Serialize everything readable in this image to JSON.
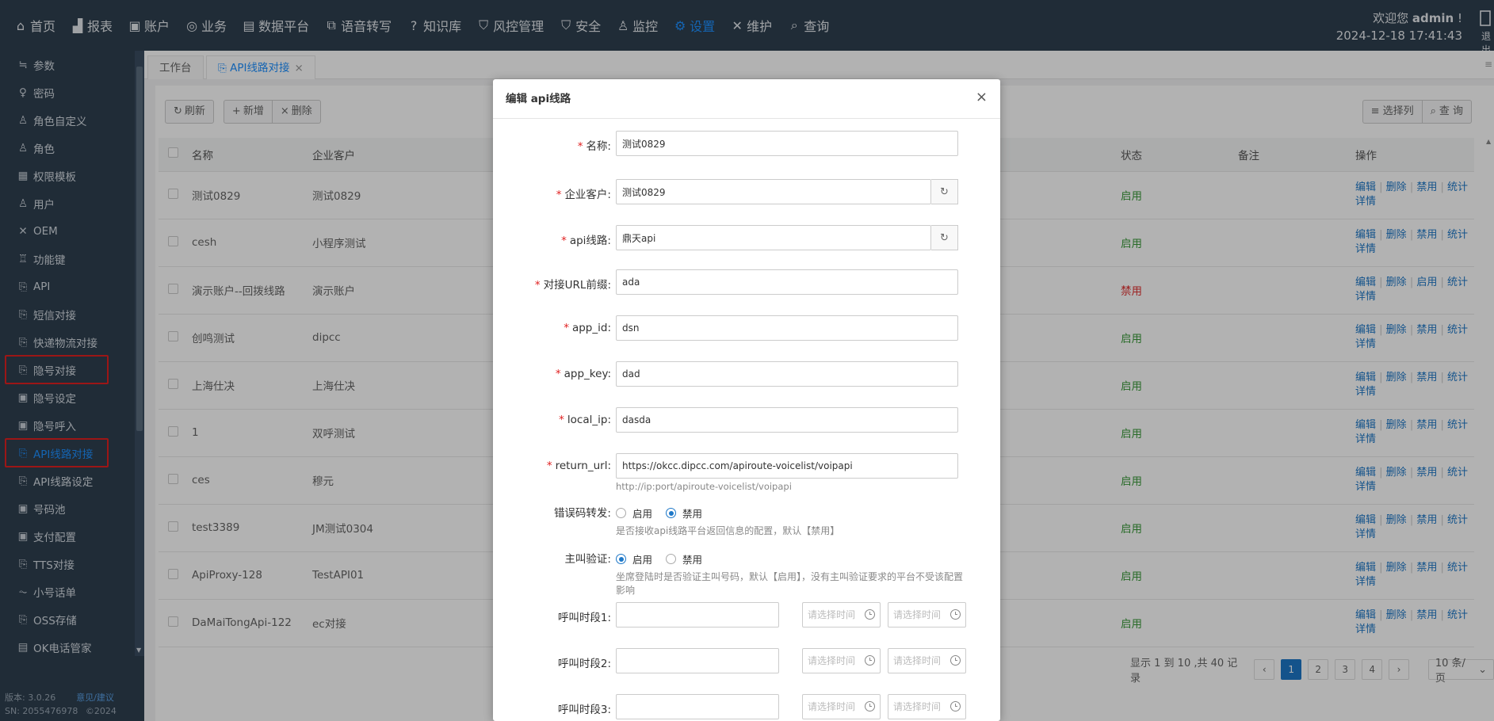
{
  "nav": {
    "items": [
      {
        "label": "首页",
        "icon": "home-icon"
      },
      {
        "label": "报表",
        "icon": "chart-icon"
      },
      {
        "label": "账户",
        "icon": "account-icon"
      },
      {
        "label": "业务",
        "icon": "business-icon"
      },
      {
        "label": "数据平台",
        "icon": "data-icon"
      },
      {
        "label": "语音转写",
        "icon": "voice-icon"
      },
      {
        "label": "知识库",
        "icon": "question-icon"
      },
      {
        "label": "风控管理",
        "icon": "shield-icon"
      },
      {
        "label": "安全",
        "icon": "safe-icon"
      },
      {
        "label": "监控",
        "icon": "monitor-icon"
      },
      {
        "label": "设置",
        "icon": "gear-icon"
      },
      {
        "label": "维护",
        "icon": "wrench-icon"
      },
      {
        "label": "查询",
        "icon": "search-icon"
      }
    ],
    "active": "设置",
    "welcome_prefix": "欢迎您",
    "username": "admin",
    "welcome_suffix": "!",
    "datetime": "2024-12-18 17:41:43",
    "logout_label": "退出"
  },
  "sidebar": {
    "items": [
      {
        "label": "参数",
        "icon": "param-icon"
      },
      {
        "label": "密码",
        "icon": "key-icon"
      },
      {
        "label": "角色自定义",
        "icon": "user-icon"
      },
      {
        "label": "角色",
        "icon": "user-icon"
      },
      {
        "label": "权限模板",
        "icon": "template-icon"
      },
      {
        "label": "用户",
        "icon": "user-icon"
      },
      {
        "label": "OEM",
        "icon": "oem-icon"
      },
      {
        "label": "功能键",
        "icon": "keyboard-icon"
      },
      {
        "label": "API",
        "icon": "plug-icon"
      },
      {
        "label": "短信对接",
        "icon": "plug-icon"
      },
      {
        "label": "快递物流对接",
        "icon": "plug-icon"
      },
      {
        "label": "隐号对接",
        "icon": "plug-icon"
      },
      {
        "label": "隐号设定",
        "icon": "box-icon"
      },
      {
        "label": "隐号呼入",
        "icon": "box-icon"
      },
      {
        "label": "API线路对接",
        "icon": "plug-icon"
      },
      {
        "label": "API线路设定",
        "icon": "plug-icon"
      },
      {
        "label": "号码池",
        "icon": "box-icon"
      },
      {
        "label": "支付配置",
        "icon": "box-icon"
      },
      {
        "label": "TTS对接",
        "icon": "plug-icon"
      },
      {
        "label": "小号话单",
        "icon": "pulse-icon"
      },
      {
        "label": "OSS存储",
        "icon": "plug-icon"
      },
      {
        "label": "OK电话管家",
        "icon": "doc-icon"
      }
    ],
    "active": "API线路对接",
    "version": "版本: 3.0.26",
    "feedback": "意见/建议",
    "sn": "SN: 2055476978",
    "copyright": "©2024"
  },
  "tabs": [
    {
      "label": "工作台"
    },
    {
      "label": "API线路对接"
    }
  ],
  "toolbar": {
    "refresh": "刷新",
    "add": "新增",
    "delete": "删除",
    "columns": "选择列",
    "query": "查 询"
  },
  "table": {
    "headers": [
      "名称",
      "企业客户",
      "状态",
      "备注",
      "操作"
    ],
    "rows": [
      {
        "name": "测试0829",
        "customer": "测试0829",
        "status": "启用",
        "ops": [
          "编辑",
          "删除",
          "禁用",
          "统计详情"
        ]
      },
      {
        "name": "cesh",
        "customer": "小程序测试",
        "status": "启用",
        "ops": [
          "编辑",
          "删除",
          "禁用",
          "统计详情"
        ]
      },
      {
        "name": "演示账户--回拨线路",
        "customer": "演示账户",
        "status": "禁用",
        "ops": [
          "编辑",
          "删除",
          "启用",
          "统计详情"
        ]
      },
      {
        "name": "创鸣测试",
        "customer": "dipcc",
        "status": "启用",
        "ops": [
          "编辑",
          "删除",
          "禁用",
          "统计详情"
        ]
      },
      {
        "name": "上海仕决",
        "customer": "上海仕决",
        "status": "启用",
        "ops": [
          "编辑",
          "删除",
          "禁用",
          "统计详情"
        ]
      },
      {
        "name": "1",
        "customer": "双呼测试",
        "status": "启用",
        "ops": [
          "编辑",
          "删除",
          "禁用",
          "统计详情"
        ]
      },
      {
        "name": "ces",
        "customer": "穆元",
        "status": "启用",
        "ops": [
          "编辑",
          "删除",
          "禁用",
          "统计详情"
        ]
      },
      {
        "name": "test3389",
        "customer": "JM测试0304",
        "status": "启用",
        "ops": [
          "编辑",
          "删除",
          "禁用",
          "统计详情"
        ]
      },
      {
        "name": "ApiProxy-128",
        "customer": "TestAPI01",
        "status": "启用",
        "ops": [
          "编辑",
          "删除",
          "禁用",
          "统计详情"
        ]
      },
      {
        "name": "DaMaiTongApi-122",
        "customer": "ec对接",
        "status": "启用",
        "ops": [
          "编辑",
          "删除",
          "禁用",
          "统计详情"
        ]
      }
    ]
  },
  "pager": {
    "summary": "显示 1 到 10 ,共 40 记录",
    "pages": [
      "1",
      "2",
      "3",
      "4"
    ],
    "current": "1",
    "size": "10 条/页"
  },
  "modal": {
    "title": "编辑 api线路",
    "fields": {
      "name": {
        "label": "名称:",
        "value": "测试0829"
      },
      "customer": {
        "label": "企业客户:",
        "value": "测试0829"
      },
      "route": {
        "label": "api线路:",
        "value": "鼎天api"
      },
      "url_prefix": {
        "label": "对接URL前缀:",
        "value": "ada"
      },
      "app_id": {
        "label": "app_id:",
        "value": "dsn"
      },
      "app_key": {
        "label": "app_key:",
        "value": "dad"
      },
      "local_ip": {
        "label": "local_ip:",
        "value": "dasda"
      },
      "return_url": {
        "label": "return_url:",
        "value": "https://okcc.dipcc.com/apiroute-voicelist/voipapi",
        "hint": "http://ip:port/apiroute-voicelist/voipapi"
      }
    },
    "error_forward": {
      "label": "错误码转发:",
      "options": [
        "启用",
        "禁用"
      ],
      "selected": "禁用",
      "hint": "是否接收api线路平台返回信息的配置，默认【禁用】"
    },
    "caller_verify": {
      "label": "主叫验证:",
      "options": [
        "启用",
        "禁用"
      ],
      "selected": "启用",
      "hint": "坐席登陆时是否验证主叫号码，默认【启用】，没有主叫验证要求的平台不受该配置影响"
    },
    "periods": [
      {
        "label": "呼叫时段1:",
        "start_placeholder": "请选择时间",
        "end_placeholder": "请选择时间"
      },
      {
        "label": "呼叫时段2:",
        "start_placeholder": "请选择时间",
        "end_placeholder": "请选择时间"
      },
      {
        "label": "呼叫时段3:",
        "start_placeholder": "请选择时间",
        "end_placeholder": "请选择时间"
      }
    ]
  }
}
